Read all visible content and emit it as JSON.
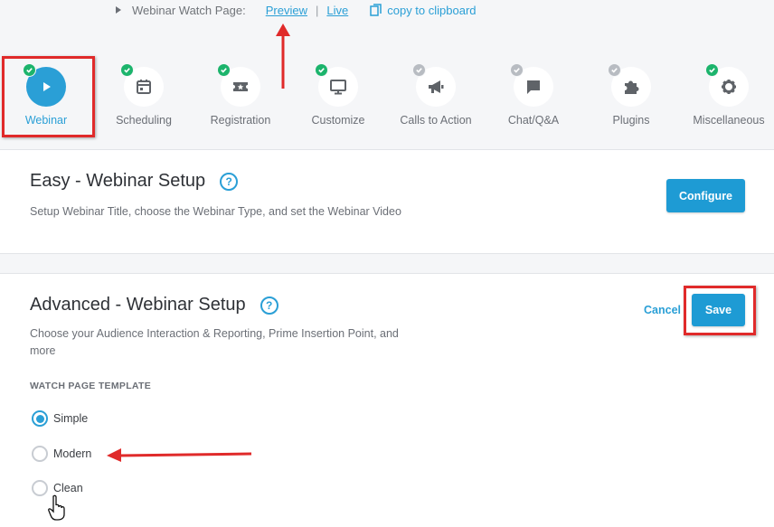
{
  "watch_page": {
    "label": "Webinar Watch Page:",
    "preview_link": "Preview",
    "separator": "|",
    "live_link": "Live",
    "copy_label": "copy to clipboard"
  },
  "steps": [
    {
      "label": "Webinar",
      "icon": "play-icon",
      "status": "done",
      "active": true
    },
    {
      "label": "Scheduling",
      "icon": "calendar-icon",
      "status": "done",
      "active": false
    },
    {
      "label": "Registration",
      "icon": "ticket-icon",
      "status": "done",
      "active": false
    },
    {
      "label": "Customize",
      "icon": "monitor-icon",
      "status": "done",
      "active": false
    },
    {
      "label": "Calls to Action",
      "icon": "megaphone-icon",
      "status": "todo",
      "active": false
    },
    {
      "label": "Chat/Q&A",
      "icon": "chat-icon",
      "status": "todo",
      "active": false
    },
    {
      "label": "Plugins",
      "icon": "puzzle-icon",
      "status": "todo",
      "active": false
    },
    {
      "label": "Miscellaneous",
      "icon": "gear-icon",
      "status": "done",
      "active": false
    }
  ],
  "easy": {
    "title": "Easy - Webinar Setup",
    "help": "?",
    "description": "Setup Webinar Title, choose the Webinar Type, and set the Webinar Video",
    "configure_label": "Configure"
  },
  "advanced": {
    "title": "Advanced - Webinar Setup",
    "help": "?",
    "description_line1": "Choose your Audience Interaction & Reporting, Prime Insertion Point, and",
    "description_line2": "more",
    "cancel_label": "Cancel",
    "save_label": "Save",
    "template_title": "WATCH PAGE TEMPLATE",
    "options": [
      {
        "label": "Simple",
        "checked": true
      },
      {
        "label": "Modern",
        "checked": false
      },
      {
        "label": "Clean",
        "checked": false
      }
    ]
  },
  "colors": {
    "accent": "#2a9fd6",
    "done": "#1cb46c",
    "todo": "#b8bcc2",
    "annotation": "#e02a2a"
  }
}
